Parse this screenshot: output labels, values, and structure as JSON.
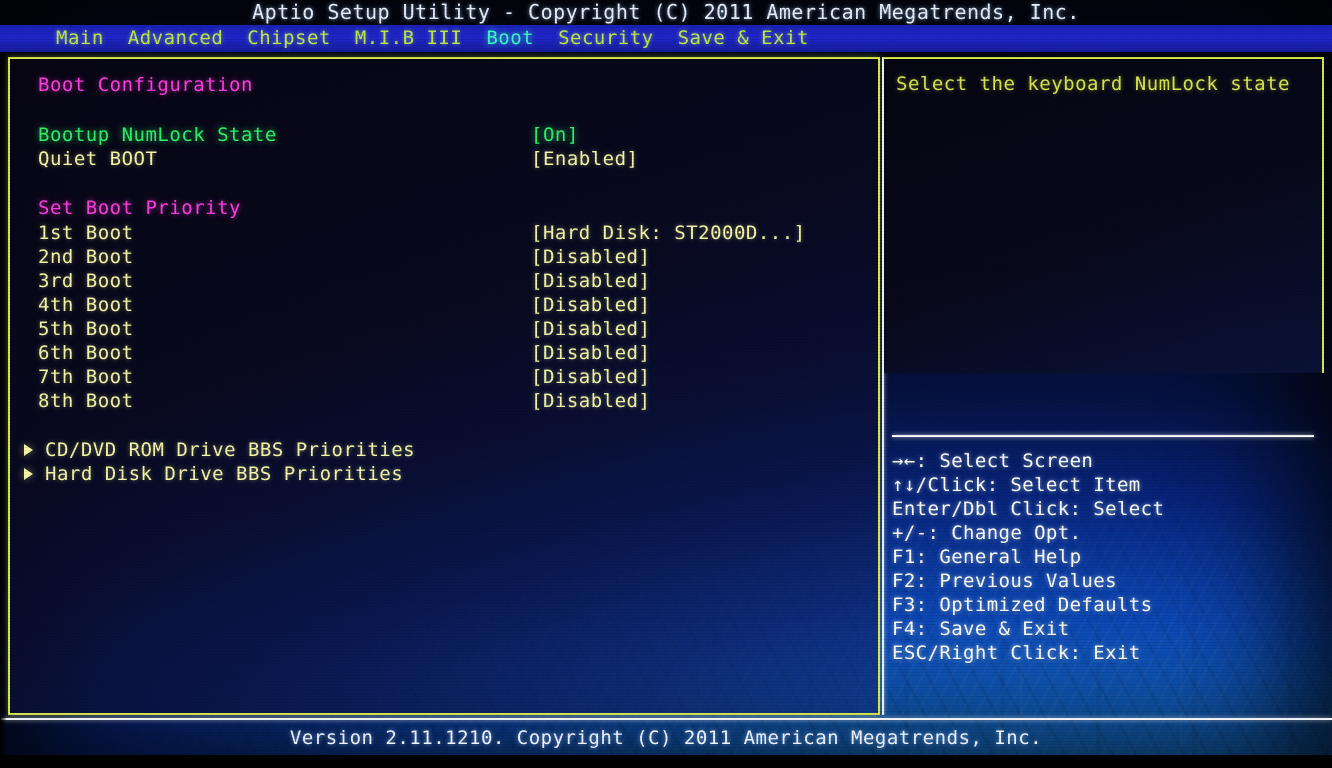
{
  "window": {
    "title": "Aptio Setup Utility - Copyright (C) 2011 American Megatrends, Inc."
  },
  "menu": {
    "items": [
      {
        "label": "Main",
        "active": false
      },
      {
        "label": "Advanced",
        "active": false
      },
      {
        "label": "Chipset",
        "active": false
      },
      {
        "label": "M.I.B III",
        "active": false
      },
      {
        "label": "Boot",
        "active": true
      },
      {
        "label": "Security",
        "active": false
      },
      {
        "label": "Save & Exit",
        "active": false
      }
    ],
    "active_color": "#3dfac8",
    "inactive_color": "#bfe84a"
  },
  "main": {
    "section_boot_config": "Boot Configuration",
    "rows_config": [
      {
        "label": "Bootup NumLock State",
        "value": "[On]",
        "selected": true
      },
      {
        "label": "Quiet BOOT",
        "value": "[Enabled]",
        "selected": false
      }
    ],
    "section_boot_priority": "Set Boot Priority",
    "rows_priority": [
      {
        "label": "1st Boot",
        "value": "[Hard Disk: ST2000D...]"
      },
      {
        "label": "2nd Boot",
        "value": "[Disabled]"
      },
      {
        "label": "3rd Boot",
        "value": "[Disabled]"
      },
      {
        "label": "4th Boot",
        "value": "[Disabled]"
      },
      {
        "label": "5th Boot",
        "value": "[Disabled]"
      },
      {
        "label": "6th Boot",
        "value": "[Disabled]"
      },
      {
        "label": "7th Boot",
        "value": "[Disabled]"
      },
      {
        "label": "8th Boot",
        "value": "[Disabled]"
      }
    ],
    "submenus": [
      {
        "label": "CD/DVD ROM Drive BBS Priorities",
        "icon": "triangle-right-icon"
      },
      {
        "label": "Hard Disk Drive BBS Priorities",
        "icon": "triangle-right-icon"
      }
    ]
  },
  "help": {
    "description": "Select the keyboard NumLock state",
    "keys": [
      "→←: Select Screen",
      "↑↓/Click: Select Item",
      "Enter/Dbl Click: Select",
      "+/-: Change Opt.",
      "F1: General Help",
      "F2: Previous Values",
      "F3: Optimized Defaults",
      "F4: Save & Exit",
      "ESC/Right Click: Exit"
    ]
  },
  "footer": {
    "version": "Version 2.11.1210. Copyright (C) 2011 American Megatrends, Inc."
  },
  "colors": {
    "selected_green": "#2ef06a",
    "normal_yellow": "#f4f6a8",
    "section_magenta": "#ff3ce0",
    "help_yellow": "#d7e64e",
    "frame_border": "#d9e84a",
    "menubar_blue": "#1d23c8",
    "key_white": "#ffffff"
  }
}
